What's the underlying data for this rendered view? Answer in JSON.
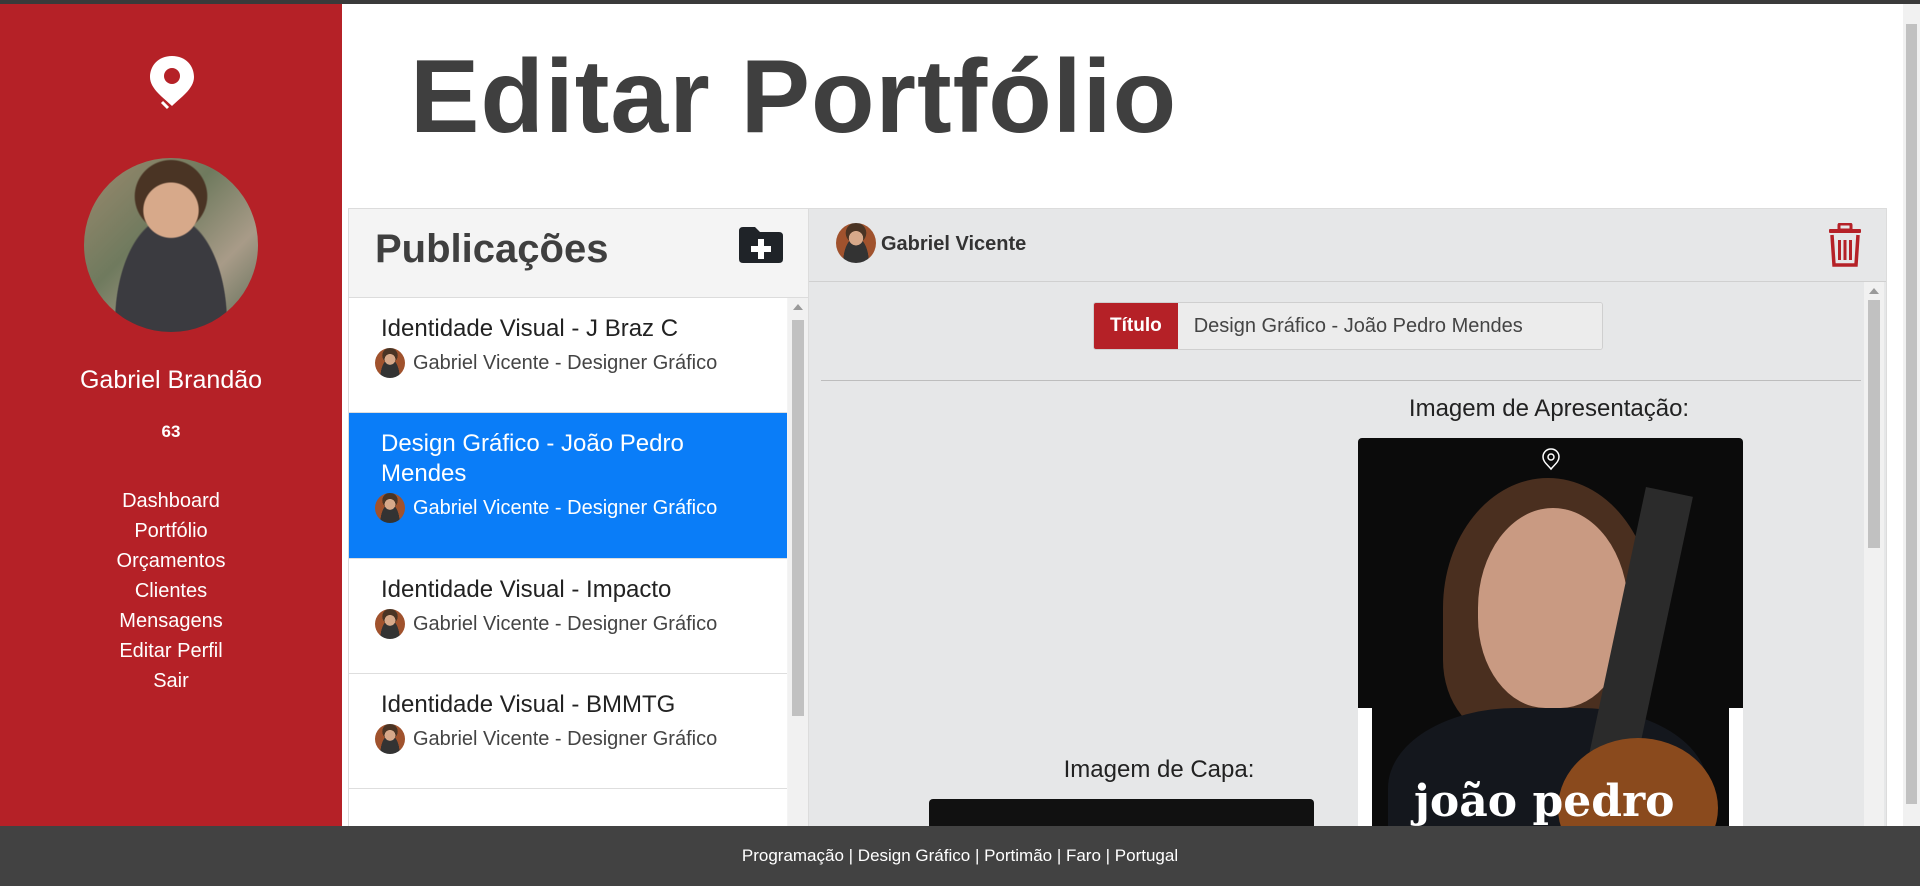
{
  "sidebar": {
    "user_name": "Gabriel Brandão",
    "count": "63",
    "nav": [
      "Dashboard",
      "Portfólio",
      "Orçamentos",
      "Clientes",
      "Mensagens",
      "Editar Perfil",
      "Sair"
    ]
  },
  "page": {
    "title": "Editar Portfólio"
  },
  "publications": {
    "header": "Publicações",
    "items": [
      {
        "title": "Identidade Visual - J Braz C",
        "author": "Gabriel Vicente - Designer Gráfico",
        "active": false
      },
      {
        "title": "Design Gráfico - João Pedro Mendes",
        "author": "Gabriel Vicente - Designer Gráfico",
        "active": true
      },
      {
        "title": "Identidade Visual - Impacto",
        "author": "Gabriel Vicente - Designer Gráfico",
        "active": false
      },
      {
        "title": "Identidade Visual - BMMTG",
        "author": "Gabriel Vicente - Designer Gráfico",
        "active": false
      }
    ]
  },
  "editor": {
    "user": "Gabriel Vicente",
    "title_label": "Título",
    "title_value": "Design Gráfico - João Pedro Mendes",
    "presentation_caption": "Imagem de Apresentação:",
    "cover_caption": "Imagem de Capa:",
    "presentation_image_text": "joão pedro"
  },
  "footer": {
    "text": "Programação | Design Gráfico | Portimão | Faro | Portugal"
  },
  "colors": {
    "brand": "#b52127",
    "active": "#0a7df8",
    "footer": "#424242"
  }
}
